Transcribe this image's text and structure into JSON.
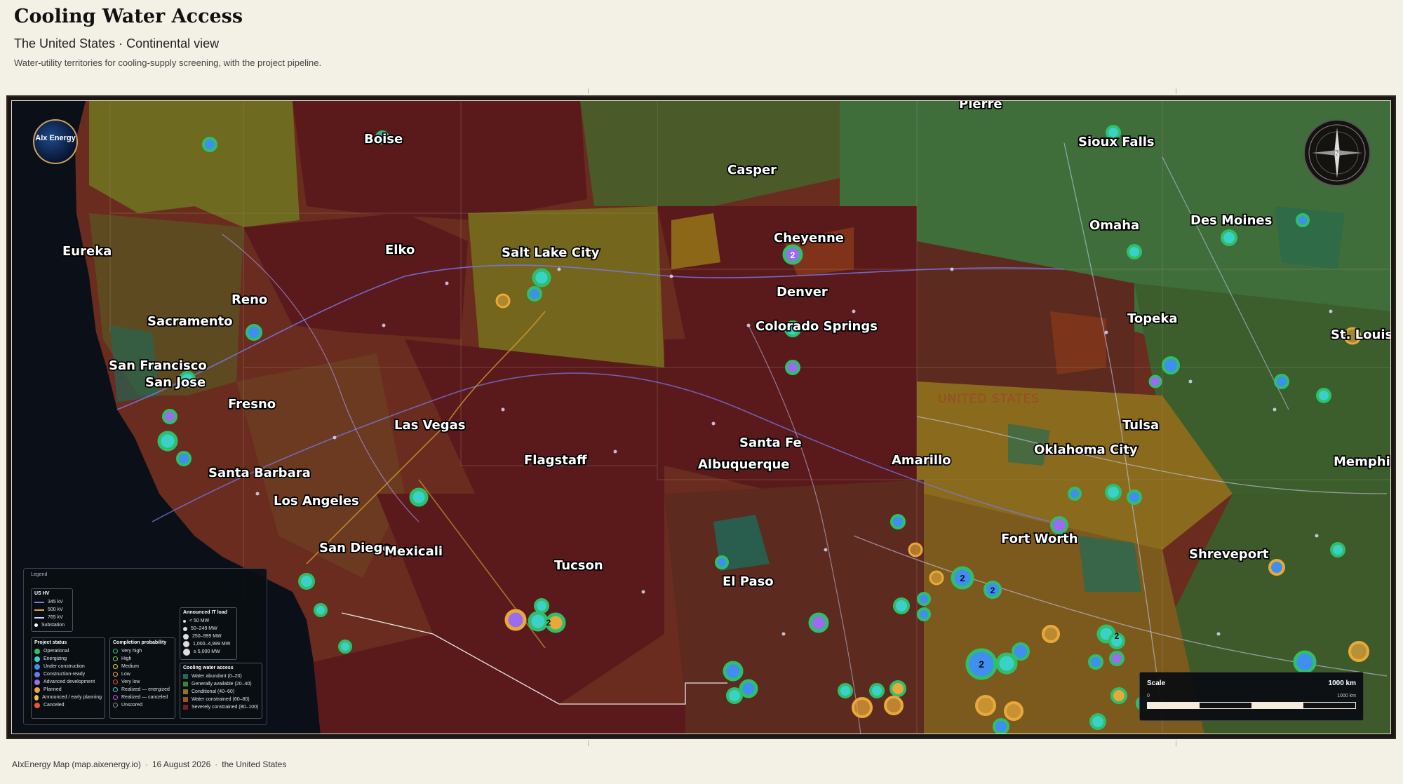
{
  "header": {
    "title": "Cooling Water Access",
    "subtitle": "The United States · Continental view",
    "description": "Water-utility territories for cooling-supply screening, with the project pipeline."
  },
  "map": {
    "logo_text": "AIx Energy",
    "country_label": "UNITED STATES",
    "compass_label": "N",
    "cities": [
      "Pierre",
      "Boise",
      "Sioux Falls",
      "Casper",
      "Eureka",
      "Elko",
      "Salt Lake City",
      "Cheyenne",
      "Omaha",
      "Des Moines",
      "Reno",
      "Denver",
      "Sacramento",
      "Topeka",
      "Colorado Springs",
      "St. Louis",
      "San Francisco",
      "San Jose",
      "Fresno",
      "Las Vegas",
      "Tulsa",
      "Santa Fe",
      "Oklahoma City",
      "Flagstaff",
      "Santa Barbara",
      "Albuquerque",
      "Amarillo",
      "Memphis",
      "Los Angeles",
      "Fort Worth",
      "San Diego",
      "Mexicali",
      "Shreveport",
      "Tucson",
      "El Paso"
    ],
    "cluster_count": "2",
    "colors": {
      "abundant": "#1d6a5a",
      "available": "#4a7a3c",
      "conditional": "#8a7a1e",
      "constrained": "#7a3a1e",
      "severe": "#5a1a1c",
      "ocean": "#0b1018",
      "operational": "#2fbf6a",
      "energizing": "#3ad1c8",
      "construction": "#3f8ef0",
      "advanced": "#9a6cf0",
      "planned": "#e8a93a",
      "canceled": "#e8553a"
    }
  },
  "legend": {
    "title": "Legend",
    "hv": {
      "title": "US HV",
      "items": [
        "345 kV",
        "500 kV",
        "765 kV",
        "Substation"
      ]
    },
    "status": {
      "title": "Project status",
      "items": [
        "Operational",
        "Energizing",
        "Under construction",
        "Construction-ready",
        "Advanced development",
        "Planned",
        "Announced / early planning",
        "Canceled"
      ]
    },
    "probability": {
      "title": "Completion probability",
      "items": [
        "Very high",
        "High",
        "Medium",
        "Low",
        "Very low",
        "Realized — energized",
        "Realized — canceled",
        "Unscored"
      ]
    },
    "load": {
      "title": "Announced IT load",
      "items": [
        "< 50 MW",
        "50–249 MW",
        "250–999 MW",
        "1,000–4,999 MW",
        "≥ 5,000 MW"
      ]
    },
    "water": {
      "title": "Cooling water access",
      "items": [
        "Water abundant (0–20)",
        "Generally available (20–40)",
        "Conditional (40–60)",
        "Water constrained (60–80)",
        "Severely constrained (80–100)"
      ]
    }
  },
  "scale": {
    "title": "Scale",
    "value": "1000 km",
    "min": "0",
    "max": "1000 km"
  },
  "footer": {
    "source": "AIxEnergy Map (map.aixenergy.io)",
    "date": "16 August 2026",
    "region": "the United States"
  }
}
